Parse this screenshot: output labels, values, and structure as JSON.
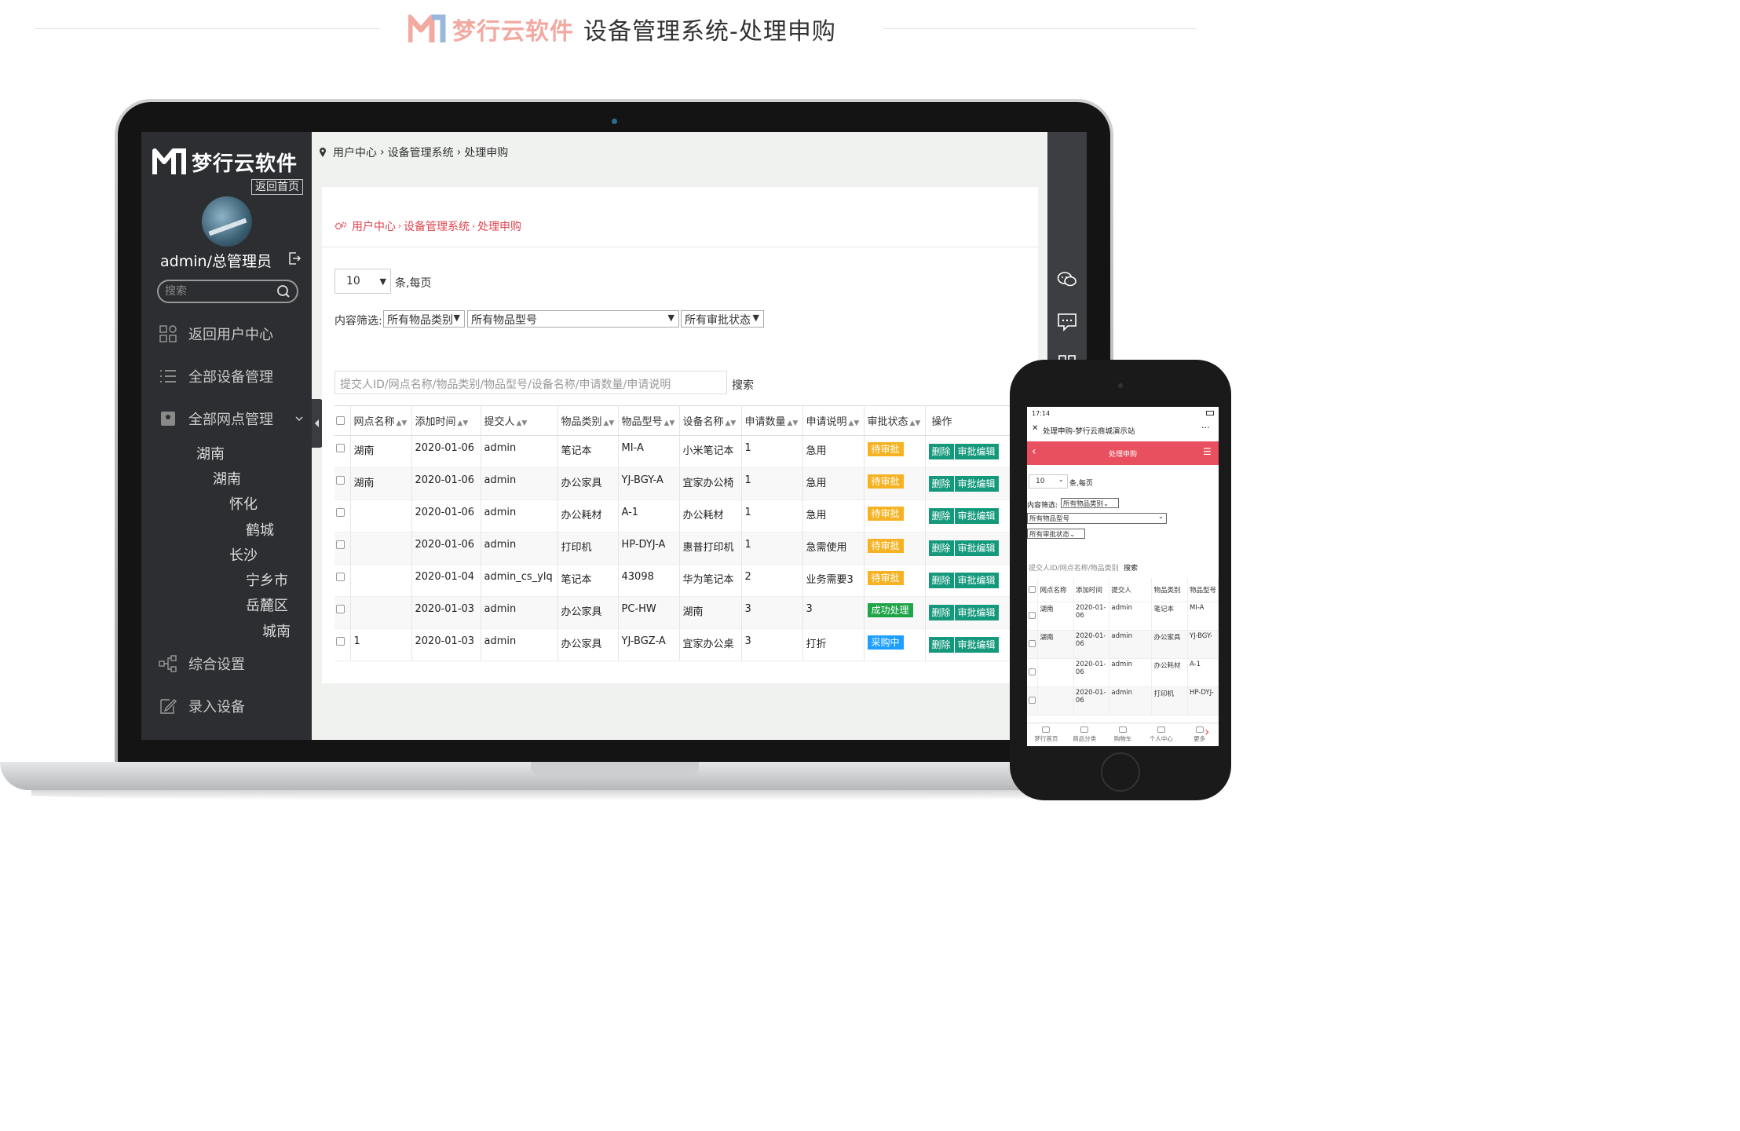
{
  "banner": {
    "brand": "梦行云软件",
    "title": "设备管理系统-处理申购"
  },
  "sidebar": {
    "logo_text": "梦行云软件",
    "home_button": "返回首页",
    "username": "admin/总管理员",
    "search_placeholder": "搜索",
    "nav": [
      {
        "label": "返回用户中心",
        "icon": "grid-icon"
      },
      {
        "label": "全部设备管理",
        "icon": "list-icon"
      },
      {
        "label": "全部网点管理",
        "icon": "map-pin-icon"
      },
      {
        "label": "综合设置",
        "icon": "sitemap-icon"
      },
      {
        "label": "录入设备",
        "icon": "edit-icon"
      }
    ],
    "tree": [
      "湖南",
      "湖南",
      "怀化",
      "鹤城",
      "长沙",
      "宁乡市",
      "岳麓区",
      "城南"
    ]
  },
  "breadcrumb_top": [
    "用户中心",
    "设备管理系统",
    "处理申购"
  ],
  "breadcrumb_panel": [
    "用户中心",
    "设备管理系统",
    "处理申购"
  ],
  "paging": {
    "size": "10",
    "suffix": "条,每页"
  },
  "filter": {
    "label": "内容筛选:",
    "category": "所有物品类别",
    "model": "所有物品型号",
    "status": "所有审批状态"
  },
  "search": {
    "placeholder": "提交人ID/网点名称/物品类别/物品型号/设备名称/申请数量/申请说明",
    "button": "搜索"
  },
  "table": {
    "headers": [
      "网点名称",
      "添加时间",
      "提交人",
      "物品类别",
      "物品型号",
      "设备名称",
      "申请数量",
      "申请说明",
      "审批状态",
      "操作"
    ],
    "rows": [
      {
        "site": "湖南",
        "time": "2020-01-06",
        "user": "admin",
        "cat": "笔记本",
        "model": "MI-A",
        "name": "小米笔记本",
        "qty": "1",
        "note": "急用",
        "status": "待审批",
        "status_type": "wait"
      },
      {
        "site": "湖南",
        "time": "2020-01-06",
        "user": "admin",
        "cat": "办公家具",
        "model": "YJ-BGY-A",
        "name": "宜家办公椅",
        "qty": "1",
        "note": "急用",
        "status": "待审批",
        "status_type": "wait"
      },
      {
        "site": "",
        "time": "2020-01-06",
        "user": "admin",
        "cat": "办公耗材",
        "model": "A-1",
        "name": "办公耗材",
        "qty": "1",
        "note": "急用",
        "status": "待审批",
        "status_type": "wait"
      },
      {
        "site": "",
        "time": "2020-01-06",
        "user": "admin",
        "cat": "打印机",
        "model": "HP-DYJ-A",
        "name": "惠普打印机",
        "qty": "1",
        "note": "急需使用",
        "status": "待审批",
        "status_type": "wait"
      },
      {
        "site": "",
        "time": "2020-01-04",
        "user": "admin_cs_ylq",
        "cat": "笔记本",
        "model": "43098",
        "name": "华为笔记本",
        "qty": "2",
        "note": "业务需要3",
        "status": "待审批",
        "status_type": "wait"
      },
      {
        "site": "",
        "time": "2020-01-03",
        "user": "admin",
        "cat": "办公家具",
        "model": "PC-HW",
        "name": "湖南",
        "qty": "3",
        "note": "3",
        "status": "成功处理",
        "status_type": "ok"
      },
      {
        "site": "1",
        "time": "2020-01-03",
        "user": "admin",
        "cat": "办公家具",
        "model": "YJ-BGZ-A",
        "name": "宜家办公桌",
        "qty": "3",
        "note": "打折",
        "status": "采购中",
        "status_type": "buy"
      }
    ],
    "action_delete": "删除",
    "action_edit": "审批编辑"
  },
  "phone": {
    "status_time": "17:14",
    "nav_title": "处理申购-梦行云商城演示站",
    "bar_title": "处理申购",
    "paging_size": "10",
    "paging_suffix": "条,每页",
    "filter_label": "内容筛选:",
    "category": "所有物品类别",
    "model": "所有物品型号",
    "status": "所有审批状态",
    "search_placeholder": "提交人ID/网点名称/物品类别",
    "search_button": "搜索",
    "headers": [
      "网点名称",
      "添加时间",
      "提交人",
      "",
      "物品类别",
      "物品型号"
    ],
    "rows": [
      {
        "site": "湖南",
        "time": "2020-01-06",
        "user": "admin",
        "cat": "笔记本",
        "model": "MI-A"
      },
      {
        "site": "湖南",
        "time": "2020-01-06",
        "user": "admin",
        "cat": "办公家具",
        "model": "YJ-BGY-"
      },
      {
        "site": "",
        "time": "2020-01-06",
        "user": "admin",
        "cat": "办公耗材",
        "model": "A-1"
      },
      {
        "site": "",
        "time": "2020-01-06",
        "user": "admin",
        "cat": "打印机",
        "model": "HP-DYJ-"
      }
    ],
    "footer": [
      "梦行首页",
      "商品分类",
      "购物车",
      "个人中心",
      "更多"
    ]
  }
}
